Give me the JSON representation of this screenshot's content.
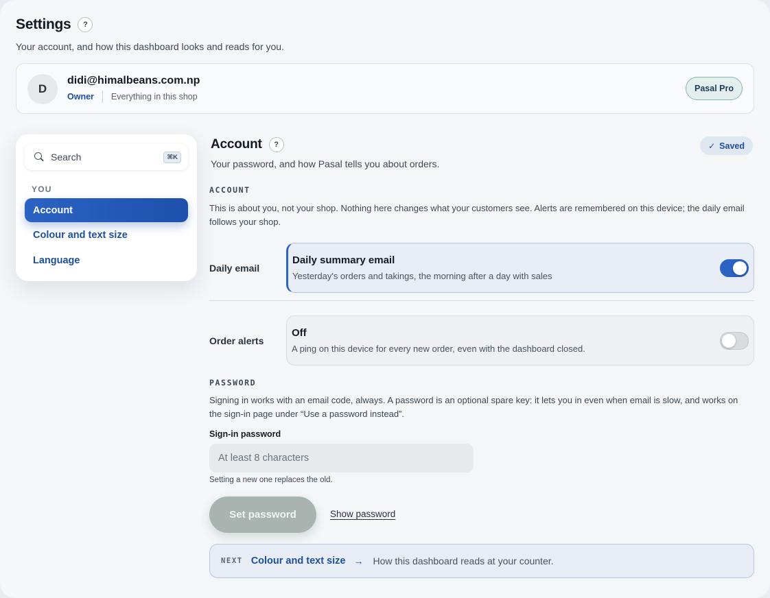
{
  "header": {
    "title": "Settings",
    "help": "?",
    "subtitle": "Your account, and how this dashboard looks and reads for you."
  },
  "profile": {
    "avatar_initial": "D",
    "email": "didi@himalbeans.com.np",
    "role": "Owner",
    "scope": "Everything in this shop",
    "plan": "Pasal Pro"
  },
  "sidebar": {
    "search_placeholder": "Search",
    "search_shortcut": "⌘K",
    "group_label": "YOU",
    "items": [
      {
        "label": "Account",
        "active": true
      },
      {
        "label": "Colour and text size",
        "active": false
      },
      {
        "label": "Language",
        "active": false
      }
    ]
  },
  "section": {
    "title": "Account",
    "help": "?",
    "description": "Your password, and how Pasal tells you about orders.",
    "saved_label": "Saved",
    "saved_icon": "check-icon"
  },
  "account": {
    "caption": "ACCOUNT",
    "paragraph": "This is about you, not your shop. Nothing here changes what your customers see. Alerts are remembered on this device; the daily email follows your shop.",
    "daily_email": {
      "row_label": "Daily email",
      "title": "Daily summary email",
      "subtitle": "Yesterday's orders and takings, the morning after a day with sales",
      "enabled": true
    },
    "order_alerts": {
      "row_label": "Order alerts",
      "title": "Off",
      "subtitle": "A ping on this device for every new order, even with the dashboard closed.",
      "enabled": false
    }
  },
  "password": {
    "caption": "PASSWORD",
    "paragraph": "Signing in works with an email code, always. A password is an optional spare key: it lets you in even when email is slow, and works on the sign-in page under “Use a password instead”.",
    "field_label": "Sign-in password",
    "placeholder": "At least 8 characters",
    "hint": "Setting a new one replaces the old.",
    "submit_label": "Set password",
    "show_label": "Show password"
  },
  "next": {
    "tag": "NEXT",
    "title": "Colour and text size",
    "arrow": "→",
    "description": "How this dashboard reads at your counter."
  },
  "colors": {
    "accent": "#2a63c4",
    "accent_text": "#1d4f9a",
    "disabled_button": "#a9b3b0",
    "plan_badge_bg": "#e2efec"
  }
}
